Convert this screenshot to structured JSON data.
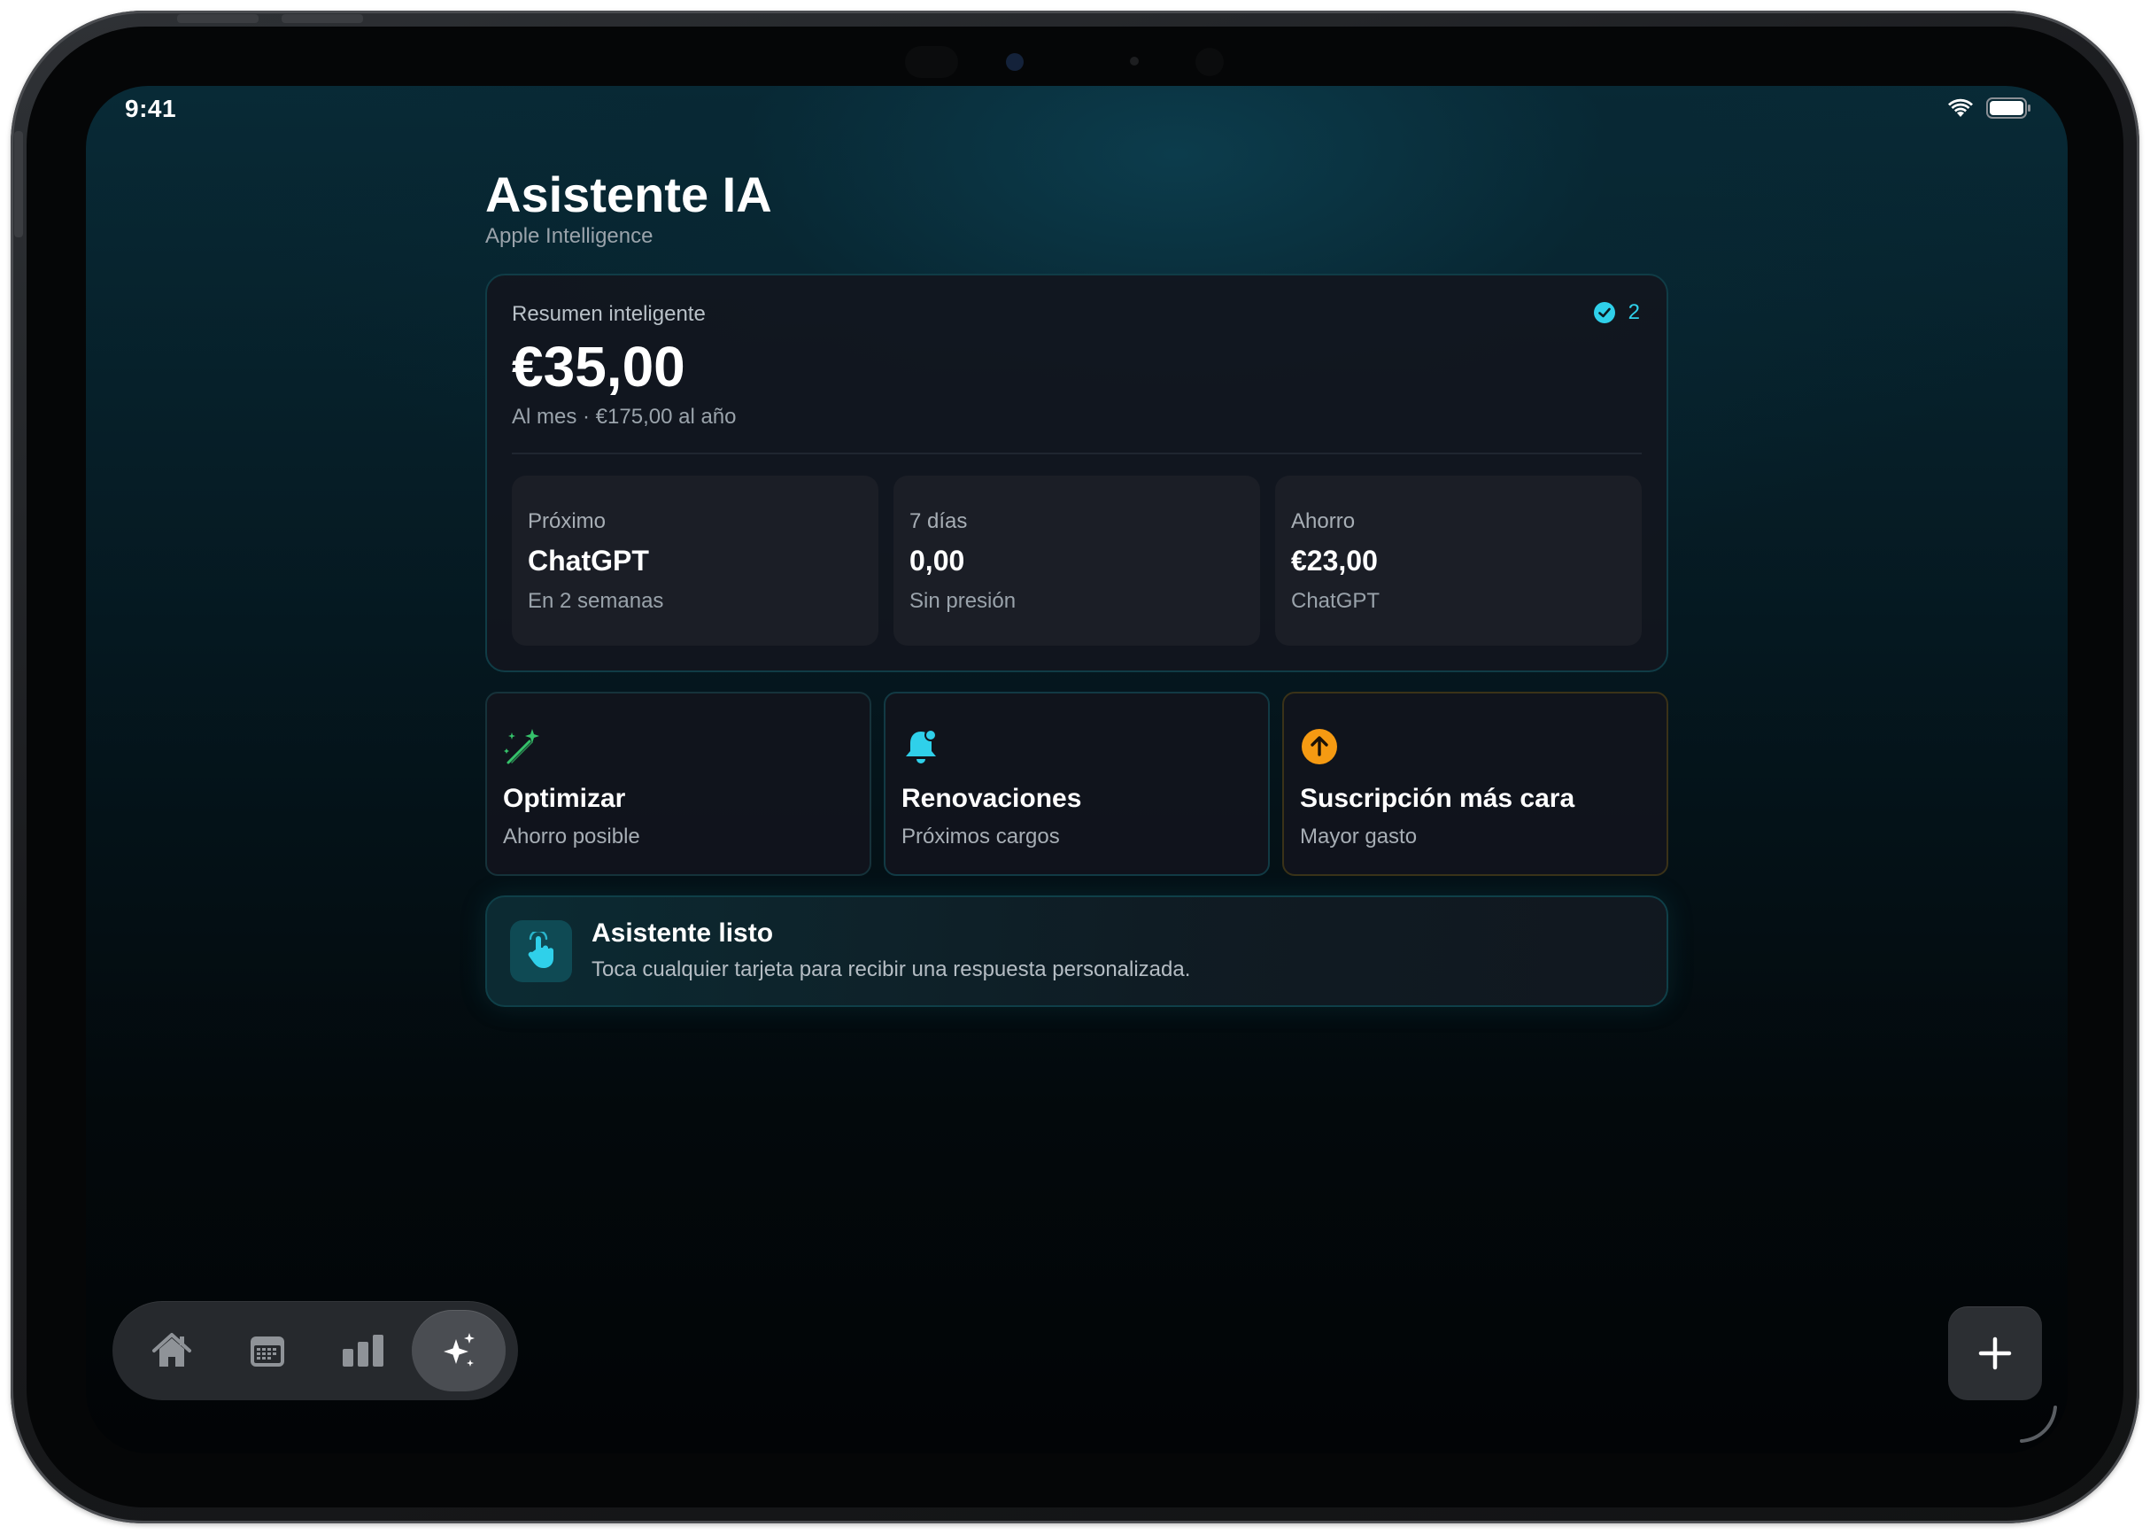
{
  "status_bar": {
    "time": "9:41",
    "icons": [
      "wifi-icon",
      "battery-icon"
    ]
  },
  "header": {
    "title": "Asistente IA",
    "subtitle": "Apple Intelligence"
  },
  "summary": {
    "label": "Resumen inteligente",
    "amount": "€35,00",
    "subtext": "Al mes · €175,00 al año",
    "badge_count": "2",
    "badge_icon": "checkmark-circle-icon",
    "stats": [
      {
        "label": "Próximo",
        "value": "ChatGPT",
        "foot": "En 2 semanas"
      },
      {
        "label": "7 días",
        "value": "0,00",
        "foot": "Sin presión"
      },
      {
        "label": "Ahorro",
        "value": "€23,00",
        "foot": "ChatGPT"
      }
    ]
  },
  "actions": [
    {
      "icon": "magic-wand-icon",
      "title": "Optimizar",
      "subtitle": "Ahorro posible",
      "accent": "#35c26a"
    },
    {
      "icon": "bell-icon",
      "title": "Renovaciones",
      "subtitle": "Próximos cargos",
      "accent": "#2fd0ea"
    },
    {
      "icon": "arrow-up-circle-icon",
      "title": "Suscripción más cara",
      "subtitle": "Mayor gasto",
      "accent": "#f59a12"
    }
  ],
  "assistant": {
    "icon": "tap-hand-icon",
    "title": "Asistente listo",
    "text": "Toca cualquier tarjeta para recibir una respuesta personalizada."
  },
  "tabbar": {
    "tabs": [
      {
        "icon": "house-icon",
        "active": false
      },
      {
        "icon": "calendar-icon",
        "active": false
      },
      {
        "icon": "bar-chart-icon",
        "active": false
      },
      {
        "icon": "sparkles-icon",
        "active": true
      }
    ]
  },
  "fab": {
    "icon": "plus-icon"
  },
  "colors": {
    "accent_cyan": "#2fd0ea",
    "accent_green": "#35c26a",
    "accent_orange": "#f59a12"
  }
}
